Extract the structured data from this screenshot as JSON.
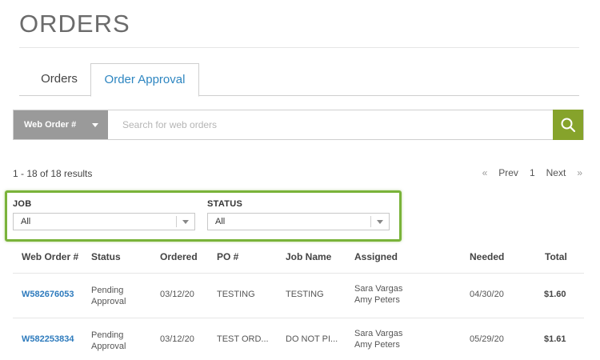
{
  "page": {
    "title": "ORDERS"
  },
  "tabs": [
    {
      "label": "Orders",
      "active": false
    },
    {
      "label": "Order Approval",
      "active": true
    }
  ],
  "search": {
    "select_label": "Web Order #",
    "placeholder": "Search for web orders",
    "value": "",
    "button_icon": "search-icon"
  },
  "results": {
    "summary": "1 - 18 of 18 results"
  },
  "pagination": {
    "first": "«",
    "prev": "Prev",
    "page": "1",
    "next": "Next",
    "last": "»"
  },
  "filters": {
    "job": {
      "label": "JOB",
      "value": "All"
    },
    "status": {
      "label": "STATUS",
      "value": "All"
    }
  },
  "colors": {
    "accent_green": "#86a32b",
    "highlight_border": "#7ab33a",
    "link_blue": "#2e7bbd"
  },
  "table": {
    "columns": [
      "Web Order #",
      "Status",
      "Ordered",
      "PO #",
      "Job Name",
      "Assigned",
      "Needed",
      "Total"
    ],
    "rows": [
      {
        "web_order": "W582676053",
        "status_line1": "Pending",
        "status_line2": "Approval",
        "ordered": "03/12/20",
        "po": "TESTING",
        "job_name": "TESTING",
        "assigned_1": "Sara Vargas",
        "assigned_2": "Amy Peters",
        "needed": "04/30/20",
        "total": "$1.60"
      },
      {
        "web_order": "W582253834",
        "status_line1": "Pending",
        "status_line2": "Approval",
        "ordered": "03/12/20",
        "po": "TEST ORD...",
        "job_name": "DO NOT PI...",
        "assigned_1": "Sara Vargas",
        "assigned_2": "Amy Peters",
        "needed": "05/29/20",
        "total": "$1.61"
      }
    ]
  }
}
